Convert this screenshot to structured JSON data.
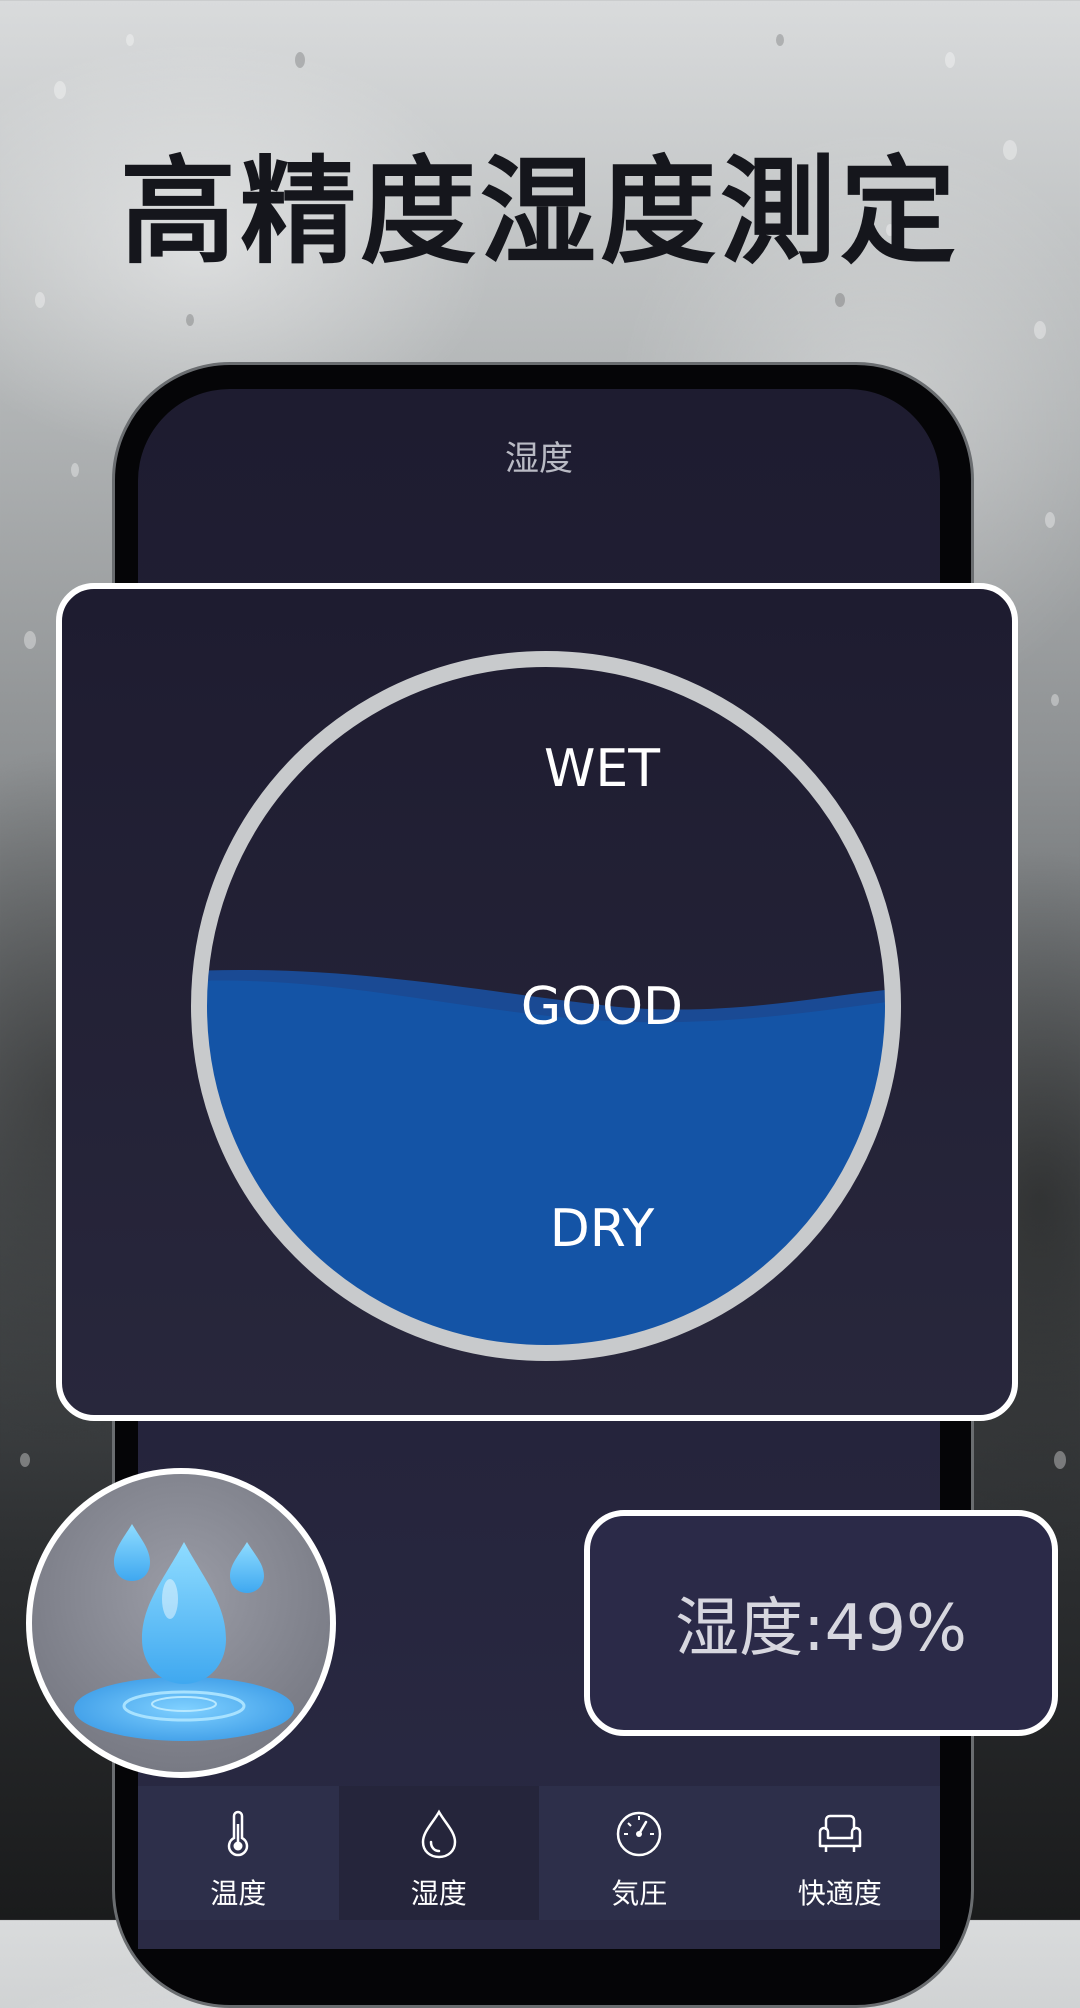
{
  "headline": "高精度湿度測定",
  "screen": {
    "title": "湿度"
  },
  "gauge": {
    "labels": {
      "top": "WET",
      "middle": "GOOD",
      "bottom": "DRY"
    },
    "fill_level": 0.49,
    "ring_color": "#c8cacc",
    "water_color": "#1454a6"
  },
  "reading": {
    "text": "湿度:49%"
  },
  "illustration": {
    "icon": "water-drops-icon"
  },
  "tabbar": {
    "tabs": [
      {
        "label": "温度",
        "icon": "thermometer-icon"
      },
      {
        "label": "湿度",
        "icon": "droplet-icon",
        "active": true
      },
      {
        "label": "気圧",
        "icon": "gauge-icon"
      },
      {
        "label": "快適度",
        "icon": "armchair-icon"
      }
    ]
  },
  "colors": {
    "screen_bg": "#1e1c30",
    "tab_bg": "#2d2f4a",
    "active_tab_bg": "#25253b"
  }
}
